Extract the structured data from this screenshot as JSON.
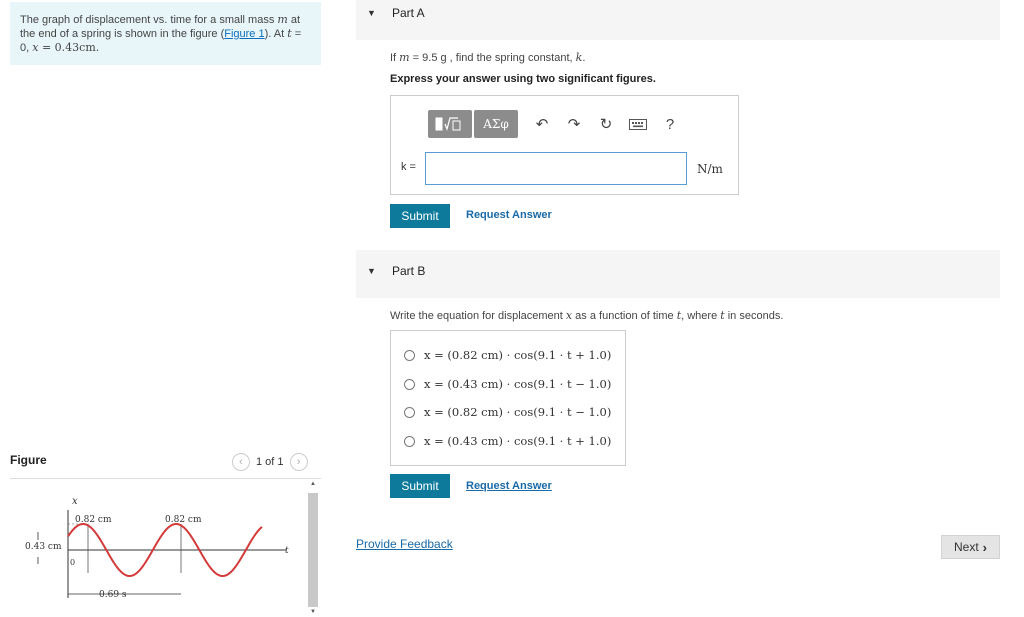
{
  "problem": {
    "text_before_link": "The graph of displacement vs. time for a small mass ",
    "mass_var": "m",
    "text_mid": " at the end of a spring is shown in the figure (",
    "link": "Figure 1",
    "text_after_link": "). At ",
    "t_var": "t",
    "text_eq": " = 0, ",
    "x_var": "x",
    "x_value": " = 0.43cm."
  },
  "figure": {
    "heading": "Figure",
    "pager": "1 of 1",
    "prev_icon": "chevron-left-icon",
    "next_icon": "chevron-right-icon",
    "x_axis_label": "x",
    "t_axis_label": "t",
    "amp_label_1": "0.82 cm",
    "amp_label_2": "0.82 cm",
    "initial_label": "0.43 cm",
    "origin_label": "0",
    "period_label": "0.69 s"
  },
  "partA": {
    "title": "Part A",
    "q_prefix": "If ",
    "q_var": "m",
    "q_mid": " = 9.5 g",
    "q_suffix": " , find the spring constant, ",
    "q_target": "k",
    "q_end": ".",
    "instruction": "Express your answer using two significant figures.",
    "toolbar": {
      "template_icon": "template-sqrt-icon",
      "greek_label": "ΑΣφ",
      "undo": "↶",
      "redo": "↷",
      "reset": "↻",
      "keyboard_icon": "keyboard-icon",
      "help": "?"
    },
    "input_label": "k =",
    "input_value": "",
    "unit": "N/m",
    "submit": "Submit",
    "request_answer": "Request Answer"
  },
  "partB": {
    "title": "Part B",
    "q_prefix": "Write the equation for displacement ",
    "q_x": "x",
    "q_mid": " as a function of time ",
    "q_t": "t",
    "q_mid2": ", where ",
    "q_t2": "t",
    "q_end": " in seconds.",
    "options": [
      "x = (0.82 cm) · cos(9.1 · t + 1.0)",
      "x = (0.43 cm) · cos(9.1 · t − 1.0)",
      "x = (0.82 cm) · cos(9.1 · t − 1.0)",
      "x = (0.43 cm) · cos(9.1 · t + 1.0)"
    ],
    "submit": "Submit",
    "request_answer": "Request Answer"
  },
  "footer": {
    "feedback": "Provide Feedback",
    "next": "Next",
    "next_icon": "›"
  },
  "colors": {
    "problem_bg": "#e8f6f9",
    "submit_bg": "#0d7a9c",
    "link": "#1a6aa8",
    "curve": "#d43a3a",
    "toolbar_btn": "#8c8c8c"
  }
}
